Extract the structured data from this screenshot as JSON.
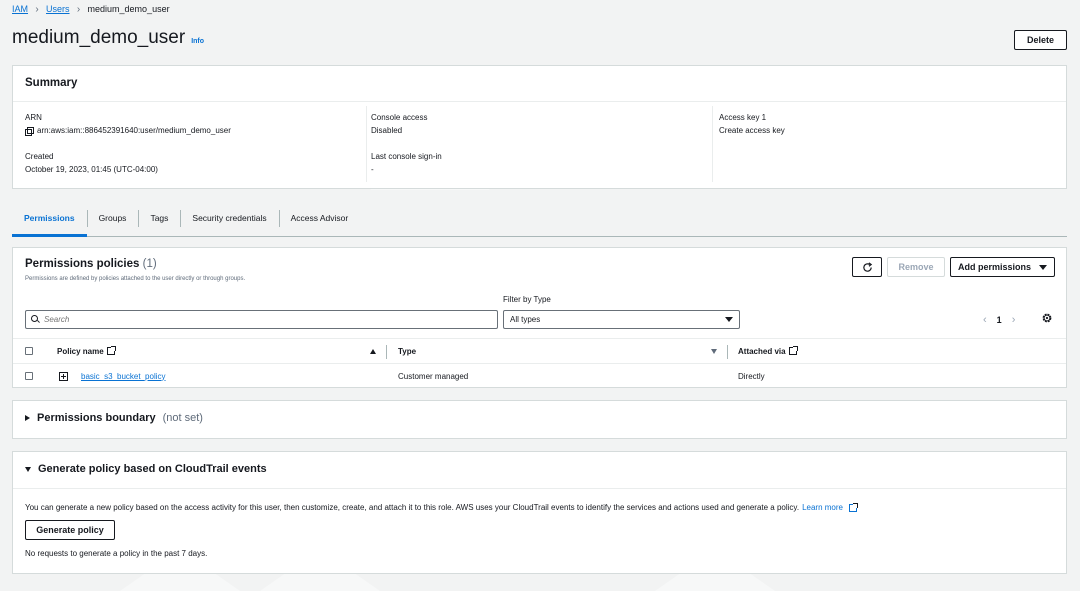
{
  "breadcrumb": {
    "items": [
      {
        "label": "IAM"
      },
      {
        "label": "Users"
      },
      {
        "label": "medium_demo_user"
      }
    ]
  },
  "header": {
    "title": "medium_demo_user",
    "info_label": "Info",
    "delete_label": "Delete"
  },
  "summary": {
    "title": "Summary",
    "arn_label": "ARN",
    "arn_value": "arn:aws:iam::886452391640:user/medium_demo_user",
    "created_label": "Created",
    "created_value": "October 19, 2023, 01:45 (UTC-04:00)",
    "console_access_label": "Console access",
    "console_access_value": "Disabled",
    "last_signin_label": "Last console sign-in",
    "last_signin_value": "-",
    "access_key_label": "Access key 1",
    "access_key_link": "Create access key"
  },
  "tabs": [
    {
      "label": "Permissions",
      "active": true
    },
    {
      "label": "Groups",
      "active": false
    },
    {
      "label": "Tags",
      "active": false
    },
    {
      "label": "Security credentials",
      "active": false
    },
    {
      "label": "Access Advisor",
      "active": false
    }
  ],
  "policies": {
    "title": "Permissions policies",
    "count": "(1)",
    "description": "Permissions are defined by policies attached to the user directly or through groups.",
    "remove_label": "Remove",
    "add_label": "Add permissions",
    "filter_label": "Filter by Type",
    "search_placeholder": "Search",
    "type_select_value": "All types",
    "page": "1",
    "columns": {
      "policy_name": "Policy name",
      "type": "Type",
      "attached_via": "Attached via"
    },
    "rows": [
      {
        "name": "basic_s3_bucket_policy",
        "type": "Customer managed",
        "attached_via": "Directly"
      }
    ]
  },
  "boundary": {
    "title": "Permissions boundary",
    "status": "(not set)"
  },
  "cloudtrail": {
    "title": "Generate policy based on CloudTrail events",
    "description": "You can generate a new policy based on the access activity for this user, then customize, create, and attach it to this role. AWS uses your CloudTrail events to identify the services and actions used and generate a policy.",
    "learn_more": "Learn more",
    "button_label": "Generate policy",
    "note": "No requests to generate a policy in the past 7 days."
  },
  "colors": {
    "link": "#0972d3",
    "text": "#16191f",
    "background": "#f2f3f3"
  }
}
